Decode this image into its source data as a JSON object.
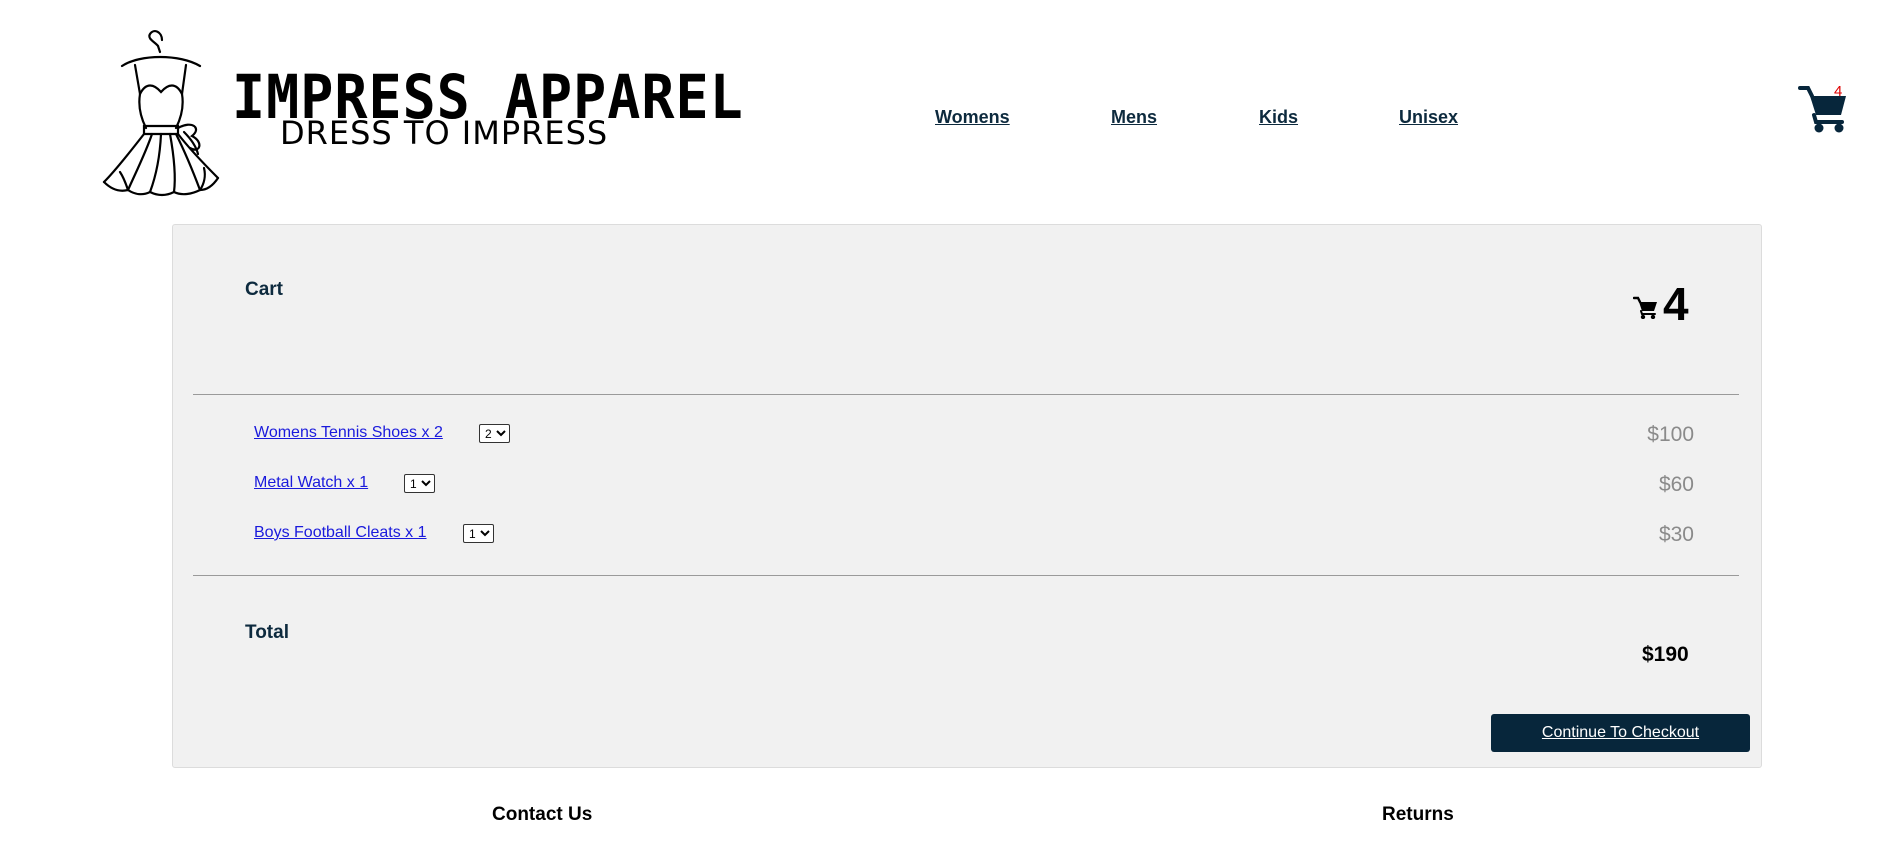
{
  "brand": {
    "title": "IMPRESS APPAREL",
    "tagline": "DRESS TO IMPRESS"
  },
  "nav": [
    {
      "label": "Womens"
    },
    {
      "label": "Mens"
    },
    {
      "label": "Kids"
    },
    {
      "label": "Unisex"
    }
  ],
  "header_cart": {
    "icon": "cart-icon",
    "count": "4"
  },
  "cart": {
    "title": "Cart",
    "count": "4",
    "items": [
      {
        "name": "Womens Tennis Shoes x 2",
        "qty": "2",
        "price": "$100"
      },
      {
        "name": "Metal Watch x 1",
        "qty": "1",
        "price": "$60"
      },
      {
        "name": "Boys Football Cleats x 1",
        "qty": "1",
        "price": "$30"
      }
    ],
    "total_label": "Total",
    "total_value": "$190",
    "checkout_label": "Continue To Checkout"
  },
  "footer": {
    "contact": "Contact Us",
    "returns": "Returns"
  },
  "colors": {
    "brand_navy": "#07263b",
    "link_blue": "#1a1adc",
    "badge_red": "#e00000",
    "panel_bg": "#f1f1f1"
  }
}
